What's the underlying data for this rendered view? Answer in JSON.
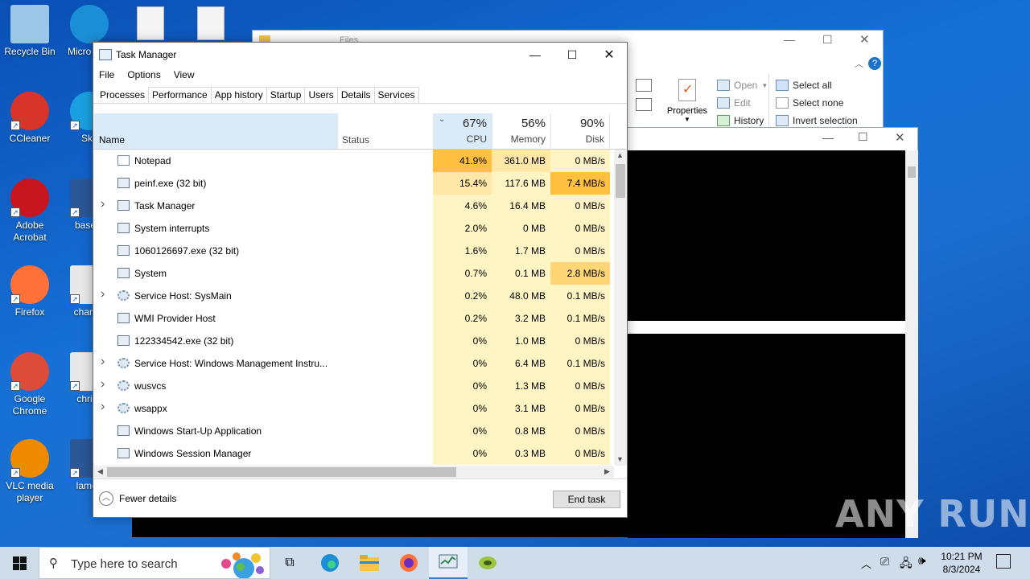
{
  "desktop": {
    "icons": [
      {
        "label": "Recycle Bin"
      },
      {
        "label": "Micro Edg"
      },
      {
        "label": "CCleaner"
      },
      {
        "label": "Sky"
      },
      {
        "label": "Adobe Acrobat"
      },
      {
        "label": "basefa"
      },
      {
        "label": "Firefox"
      },
      {
        "label": "chance"
      },
      {
        "label": "Google Chrome"
      },
      {
        "label": "christi"
      },
      {
        "label": "VLC media player"
      },
      {
        "label": "lamou"
      }
    ]
  },
  "explorer": {
    "title": "Files",
    "properties": "Properties",
    "open": "Open",
    "edit": "Edit",
    "history": "History",
    "select_all": "Select all",
    "select_none": "Select none",
    "invert_selection": "Invert selection"
  },
  "task_manager": {
    "title": "Task Manager",
    "menu": [
      "File",
      "Options",
      "View"
    ],
    "tabs": [
      "Processes",
      "Performance",
      "App history",
      "Startup",
      "Users",
      "Details",
      "Services"
    ],
    "columns": {
      "name": "Name",
      "status": "Status",
      "cpu": {
        "pct": "67%",
        "label": "CPU"
      },
      "memory": {
        "pct": "56%",
        "label": "Memory"
      },
      "disk": {
        "pct": "90%",
        "label": "Disk"
      }
    },
    "rows": [
      {
        "name": "Notepad",
        "expandable": false,
        "icon": "notepad-icon",
        "cpu": "41.9%",
        "memory": "361.0 MB",
        "disk": "0 MB/s"
      },
      {
        "name": "peinf.exe (32 bit)",
        "expandable": false,
        "icon": "app-window-icon",
        "cpu": "15.4%",
        "memory": "117.6 MB",
        "disk": "7.4 MB/s"
      },
      {
        "name": "Task Manager",
        "expandable": true,
        "icon": "task-manager-icon",
        "cpu": "4.6%",
        "memory": "16.4 MB",
        "disk": "0 MB/s"
      },
      {
        "name": "System interrupts",
        "expandable": false,
        "icon": "app-window-icon",
        "cpu": "2.0%",
        "memory": "0 MB",
        "disk": "0 MB/s"
      },
      {
        "name": "1060126697.exe (32 bit)",
        "expandable": false,
        "icon": "app-window-icon",
        "cpu": "1.6%",
        "memory": "1.7 MB",
        "disk": "0 MB/s"
      },
      {
        "name": "System",
        "expandable": false,
        "icon": "app-window-icon",
        "cpu": "0.7%",
        "memory": "0.1 MB",
        "disk": "2.8 MB/s"
      },
      {
        "name": "Service Host: SysMain",
        "expandable": true,
        "icon": "gear-icon",
        "cpu": "0.2%",
        "memory": "48.0 MB",
        "disk": "0.1 MB/s"
      },
      {
        "name": "WMI Provider Host",
        "expandable": false,
        "icon": "wmi-icon",
        "cpu": "0.2%",
        "memory": "3.2 MB",
        "disk": "0.1 MB/s"
      },
      {
        "name": "122334542.exe (32 bit)",
        "expandable": false,
        "icon": "app-window-icon",
        "cpu": "0%",
        "memory": "1.0 MB",
        "disk": "0 MB/s"
      },
      {
        "name": "Service Host: Windows Management Instru...",
        "expandable": true,
        "icon": "gear-icon",
        "cpu": "0%",
        "memory": "6.4 MB",
        "disk": "0.1 MB/s"
      },
      {
        "name": "wusvcs",
        "expandable": true,
        "icon": "gear-icon",
        "cpu": "0%",
        "memory": "1.3 MB",
        "disk": "0 MB/s"
      },
      {
        "name": "wsappx",
        "expandable": true,
        "icon": "gear-icon",
        "cpu": "0%",
        "memory": "3.1 MB",
        "disk": "0 MB/s"
      },
      {
        "name": "Windows Start-Up Application",
        "expandable": false,
        "icon": "app-window-icon",
        "cpu": "0%",
        "memory": "0.8 MB",
        "disk": "0 MB/s"
      },
      {
        "name": "Windows Session Manager",
        "expandable": false,
        "icon": "app-window-icon",
        "cpu": "0%",
        "memory": "0.3 MB",
        "disk": "0 MB/s"
      }
    ],
    "fewer_details": "Fewer details",
    "end_task": "End task"
  },
  "taskbar": {
    "search_placeholder": "Type here to search",
    "clock_time": "10:21 PM",
    "clock_date": "8/3/2024"
  },
  "watermark": "ANY RUN",
  "colors": {
    "desktop_blue": "#1670d6",
    "heat_high": "#ffc040",
    "heat_mid": "#ffe7a8",
    "heat_low": "#fff4c4",
    "header_selected": "#d9ebf9"
  }
}
